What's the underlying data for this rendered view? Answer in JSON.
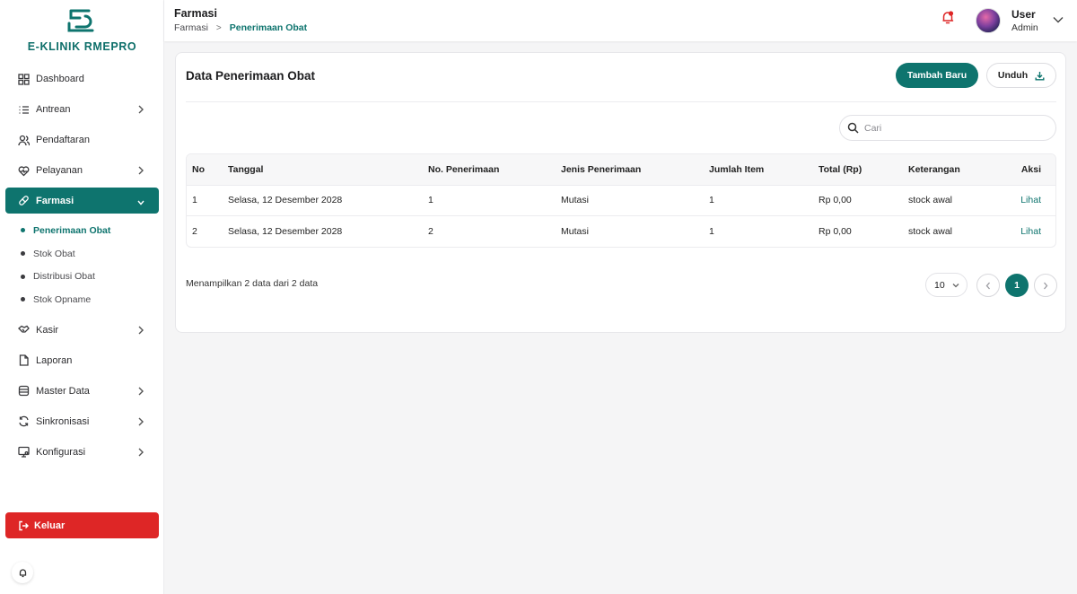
{
  "brand": {
    "name": "E-KLINIK RMEPRO"
  },
  "sidebar": {
    "items": [
      {
        "label": "Dashboard",
        "icon": "grid-icon",
        "has_chevron": false
      },
      {
        "label": "Antrean",
        "icon": "list-icon",
        "has_chevron": true
      },
      {
        "label": "Pendaftaran",
        "icon": "users-icon",
        "has_chevron": false
      },
      {
        "label": "Pelayanan",
        "icon": "heart-pulse-icon",
        "has_chevron": true
      },
      {
        "label": "Farmasi",
        "icon": "pill-icon",
        "has_chevron": true,
        "active": true,
        "children": [
          {
            "label": "Penerimaan Obat",
            "active": true
          },
          {
            "label": "Stok Obat"
          },
          {
            "label": "Distribusi Obat"
          },
          {
            "label": "Stok Opname"
          }
        ]
      },
      {
        "label": "Kasir",
        "icon": "handshake-icon",
        "has_chevron": true
      },
      {
        "label": "Laporan",
        "icon": "file-icon",
        "has_chevron": false
      },
      {
        "label": "Master Data",
        "icon": "database-icon",
        "has_chevron": true
      },
      {
        "label": "Sinkronisasi",
        "icon": "refresh-icon",
        "has_chevron": true
      },
      {
        "label": "Konfigurasi",
        "icon": "monitor-settings-icon",
        "has_chevron": true
      }
    ],
    "logout_label": "Keluar"
  },
  "header": {
    "title": "Farmasi",
    "breadcrumb": {
      "parent": "Farmasi",
      "separator": ">",
      "current": "Penerimaan Obat"
    },
    "user": {
      "name": "User",
      "role": "Admin"
    }
  },
  "card": {
    "title": "Data Penerimaan Obat",
    "add_button": "Tambah Baru",
    "download_button": "Unduh",
    "search_placeholder": "Cari"
  },
  "table": {
    "headers": [
      "No",
      "Tanggal",
      "No. Penerimaan",
      "Jenis Penerimaan",
      "Jumlah Item",
      "Total (Rp)",
      "Keterangan",
      "Aksi"
    ],
    "rows": [
      [
        "1",
        "Selasa, 12 Desember 2028",
        "1",
        "Mutasi",
        "1",
        "Rp 0,00",
        "stock awal",
        "Lihat"
      ],
      [
        "2",
        "Selasa, 12 Desember 2028",
        "2",
        "Mutasi",
        "1",
        "Rp 0,00",
        "stock awal",
        "Lihat"
      ]
    ]
  },
  "footer": {
    "summary": "Menampilkan 2 data dari 2 data",
    "page_size": "10",
    "current_page": "1"
  },
  "colors": {
    "primary": "#0e746e",
    "danger": "#de2626"
  }
}
